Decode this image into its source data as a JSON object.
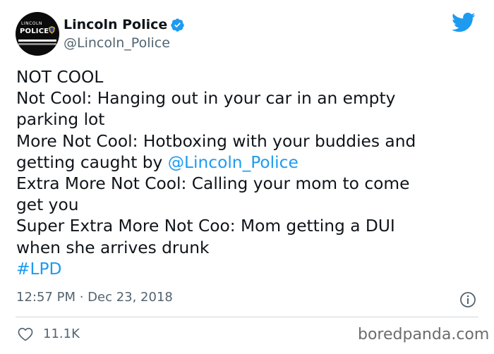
{
  "account": {
    "display_name": "Lincoln Police",
    "handle": "@Lincoln_Police",
    "avatar_text_top": "LINCOLN",
    "avatar_text_main": "POLICE",
    "verified": true
  },
  "tweet": {
    "lines": [
      {
        "text": "NOT COOL"
      },
      {
        "text": "Not Cool: Hanging out in your car in an empty"
      },
      {
        "text": "parking lot"
      },
      {
        "text": "More Not Cool: Hotboxing with your buddies and"
      },
      {
        "text": "getting caught by ",
        "mention": "@Lincoln_Police"
      },
      {
        "text": "Extra More Not Cool: Calling your mom to come"
      },
      {
        "text": "get you"
      },
      {
        "text": "Super Extra More Not Coo: Mom getting a DUI"
      },
      {
        "text": "when she arrives drunk"
      }
    ],
    "hashtag": "#LPD",
    "timestamp": "12:57 PM · Dec 23, 2018"
  },
  "engagement": {
    "likes": "11.1K"
  },
  "watermark": "boredpanda.com",
  "icons": {
    "brand": "twitter-bird-icon",
    "verified": "verified-badge-icon",
    "info": "info-icon",
    "like": "heart-icon"
  },
  "colors": {
    "link": "#1d9bf0",
    "twitter_brand": "#1d9bf0",
    "secondary_text": "#536471"
  }
}
